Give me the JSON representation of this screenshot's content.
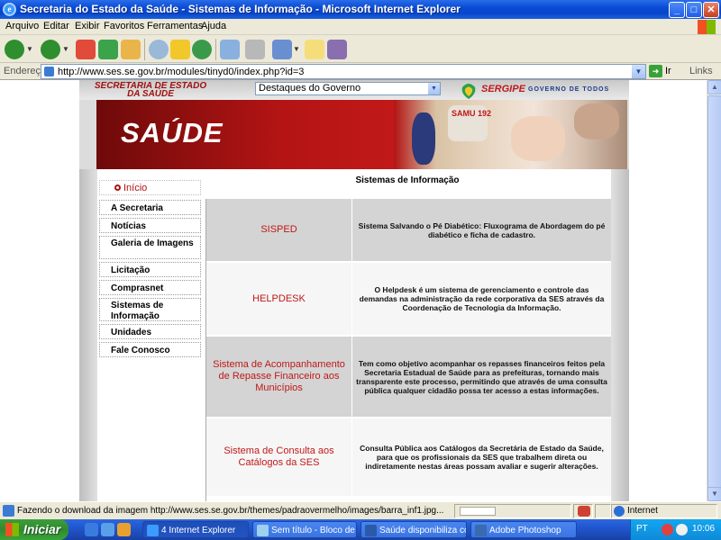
{
  "window": {
    "title": "Secretaria do Estado da Saúde - Sistemas de Informação - Microsoft Internet Explorer",
    "controls": {
      "minimize": "_",
      "maximize": "□",
      "close": "✕"
    }
  },
  "menu": [
    "Arquivo",
    "Editar",
    "Exibir",
    "Favoritos",
    "Ferramentas",
    "Ajuda"
  ],
  "address": {
    "label": "Endereço",
    "url": "http://www.ses.se.gov.br/modules/tinyd0/index.php?id=3",
    "go_label": "Ir",
    "links_label": "Links"
  },
  "site": {
    "org_name": "SECRETARIA DE ESTADO DA SAÚDE",
    "gov_select_value": "Destaques do Governo",
    "brand": "SERGIPE",
    "brand_tagline": "GOVERNO DE TODOS",
    "banner_title": "SAÚDE",
    "banner_photo_text": "SAMU 192"
  },
  "sidebar": {
    "items": [
      "Início",
      "A Secretaria",
      "Notícias",
      "Galeria de Imagens",
      "Licitação",
      "Comprasnet",
      "Sistemas de Informação",
      "Unidades",
      "Fale Conosco"
    ]
  },
  "main": {
    "heading": "Sistemas de Informação",
    "systems": [
      {
        "name": "SISPED",
        "description": "Sistema Salvando o Pé Diabético: Fluxograma de Abordagem do pé diabético e ficha de cadastro."
      },
      {
        "name": "HELPDESK",
        "description": "O Helpdesk é um sistema de gerenciamento e controle das demandas na administração da rede corporativa da SES através da Coordenação de Tecnologia da Informação."
      },
      {
        "name": "Sistema de Acompanhamento de Repasse Financeiro aos Municípios",
        "description": "Tem como objetivo acompanhar os repasses financeiros feitos pela Secretaria Estadual de Saúde para as prefeituras, tornando mais transparente este processo, permitindo que através de uma consulta pública qualquer cidadão possa ter acesso a estas informações."
      },
      {
        "name": "Sistema de Consulta aos Catálogos da SES",
        "description": "Consulta Pública aos Catálogos da Secretária de Estado da Saúde, para que os profissionais da SES que trabalhem direta ou indiretamente nestas áreas possam avaliar e sugerir alterações."
      }
    ]
  },
  "status": {
    "text": "Fazendo o download da imagem http://www.ses.se.gov.br/themes/padraovermelho/images/barra_inf1.jpg...",
    "zone": "Internet",
    "progress_fraction": 0.0
  },
  "taskbar": {
    "start_label": "Iniciar",
    "tasks": [
      {
        "label": "4 Internet Explorer",
        "icon": "ie-icon"
      },
      {
        "label": "Sem título - Bloco de ...",
        "icon": "notepad-icon"
      },
      {
        "label": "Saúde disponibiliza co...",
        "icon": "word-icon"
      },
      {
        "label": "Adobe Photoshop",
        "icon": "photoshop-icon"
      }
    ],
    "language": "PT",
    "clock": "10:06"
  },
  "colors": {
    "title_bar": "#0a4bd6",
    "site_red": "#b41414",
    "link_red": "#c01818",
    "row_gray": "#d4d4d4",
    "taskbar": "#245edb",
    "start_green": "#3c9e3c"
  }
}
